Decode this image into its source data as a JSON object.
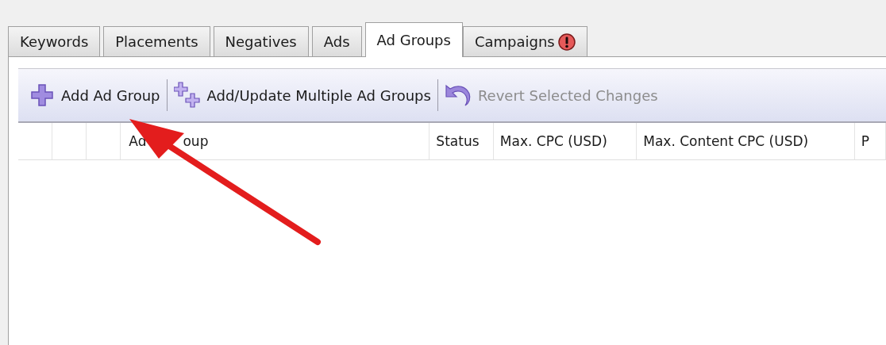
{
  "tabs": [
    {
      "label": "Keywords",
      "selected": false,
      "warning": false
    },
    {
      "label": "Placements",
      "selected": false,
      "warning": false
    },
    {
      "label": "Negatives",
      "selected": false,
      "warning": false
    },
    {
      "label": "Ads",
      "selected": false,
      "warning": false
    },
    {
      "label": "Ad Groups",
      "selected": true,
      "warning": false
    },
    {
      "label": "Campaigns",
      "selected": false,
      "warning": true
    }
  ],
  "toolbar": [
    {
      "kind": "add",
      "label": "Add Ad Group",
      "disabled": false
    },
    {
      "kind": "add-multiple",
      "label": "Add/Update Multiple Ad Groups",
      "disabled": false
    },
    {
      "kind": "revert",
      "label": "Revert Selected Changes",
      "disabled": true
    }
  ],
  "table": {
    "columns": [
      {
        "label": "Ad",
        "covered_tail": "oup"
      },
      {
        "label": "Status"
      },
      {
        "label": "Max. CPC (USD)"
      },
      {
        "label": "Max. Content CPC (USD)"
      },
      {
        "label": "P"
      }
    ]
  }
}
